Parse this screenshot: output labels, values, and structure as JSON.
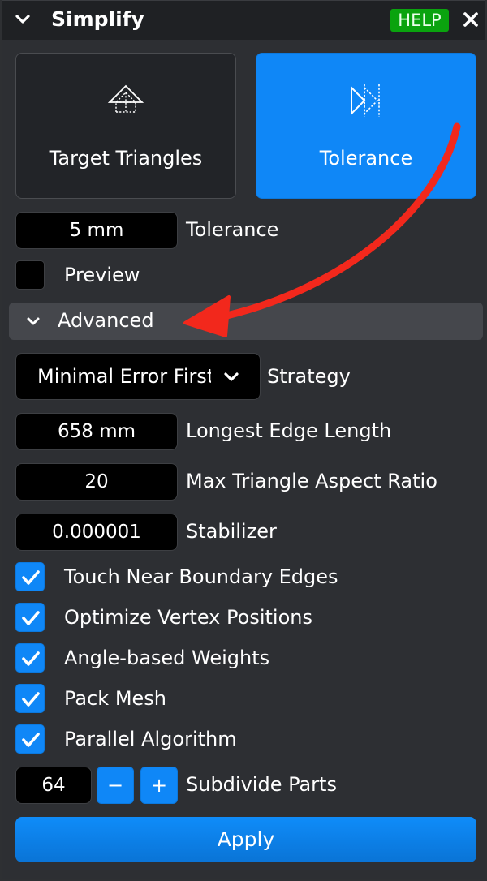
{
  "titlebar": {
    "title": "Simplify",
    "help_label": "HELP"
  },
  "modes": [
    {
      "label": "Target Triangles",
      "selected": false,
      "icon": "target-triangles-icon"
    },
    {
      "label": "Tolerance",
      "selected": true,
      "icon": "tolerance-icon"
    }
  ],
  "tolerance": {
    "value": "5 mm",
    "label": "Tolerance"
  },
  "preview": {
    "label": "Preview",
    "checked": false
  },
  "advanced": {
    "label": "Advanced",
    "expanded": true
  },
  "strategy": {
    "value": "Minimal Error First",
    "label": "Strategy"
  },
  "longest_edge": {
    "value": "658 mm",
    "label": "Longest Edge Length"
  },
  "aspect_ratio": {
    "value": "20",
    "label": "Max Triangle Aspect Ratio"
  },
  "stabilizer": {
    "value": "0.000001",
    "label": "Stabilizer"
  },
  "options": [
    {
      "label": "Touch Near Boundary Edges",
      "checked": true
    },
    {
      "label": "Optimize Vertex Positions",
      "checked": true
    },
    {
      "label": "Angle-based Weights",
      "checked": true
    },
    {
      "label": "Pack Mesh",
      "checked": true
    },
    {
      "label": "Parallel Algorithm",
      "checked": true
    }
  ],
  "subdivide": {
    "value": "64",
    "minus": "−",
    "plus": "+",
    "label": "Subdivide Parts"
  },
  "apply_label": "Apply",
  "colors": {
    "accent": "#0f87f7",
    "help": "#0aa30e",
    "annotation_arrow": "#f2281c"
  }
}
